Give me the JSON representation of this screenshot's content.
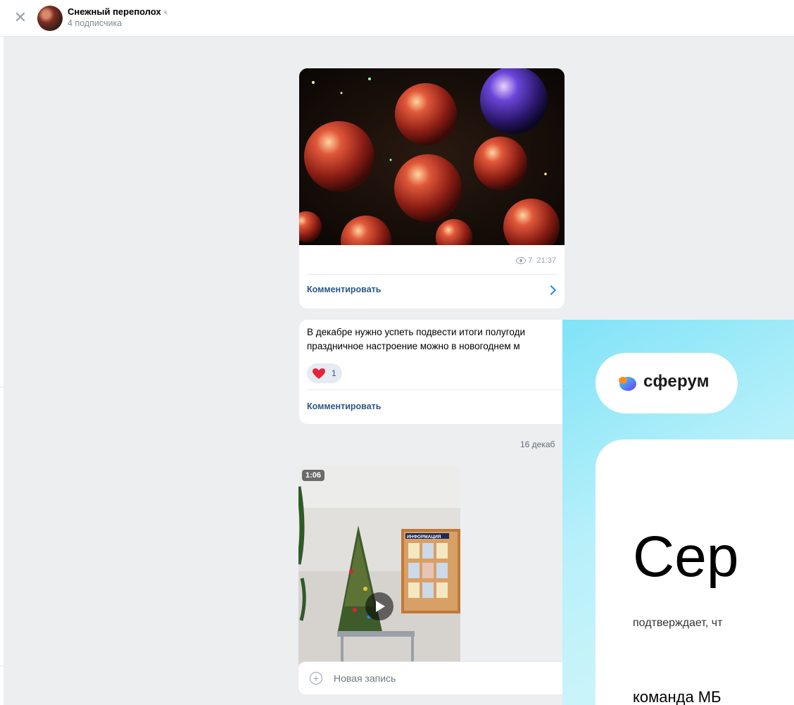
{
  "header": {
    "title": "Снежный переполох",
    "subscribers": "4 подписчика"
  },
  "post1": {
    "views": "7",
    "time": "21:37",
    "comment_label": "Комментировать"
  },
  "post2": {
    "text_line1": "В декабре нужно успеть подвести итоги полугоди",
    "text_line2": "праздничное настроение можно в новогоднем м",
    "reaction_count": "1",
    "comment_label": "Комментировать"
  },
  "date_separator": "16 декаб",
  "video": {
    "duration": "1:06",
    "poster_sign": "ИНФОРМАЦИЯ"
  },
  "composer": {
    "placeholder": "Новая запись"
  },
  "ad": {
    "logo_text": "сферум",
    "heading": "Сер",
    "subtitle": "подтверждает, чт",
    "team": "команда МБ"
  },
  "colors": {
    "link": "#2a5885",
    "accent": "#2688eb",
    "background": "#edeef0"
  }
}
